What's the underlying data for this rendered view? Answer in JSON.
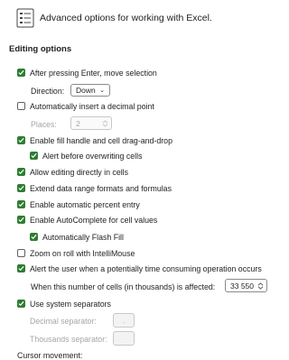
{
  "header": {
    "title": "Advanced options for working with Excel.",
    "icon": "sliders-list-icon"
  },
  "section": {
    "title": "Editing options"
  },
  "options": {
    "after_enter": {
      "label": "After pressing Enter, move selection",
      "checked": true
    },
    "direction": {
      "label": "Direction:",
      "value": "Down"
    },
    "auto_decimal": {
      "label": "Automatically insert a decimal point",
      "checked": false
    },
    "places": {
      "label": "Places:",
      "value": "2"
    },
    "fill_handle": {
      "label": "Enable fill handle and cell drag-and-drop",
      "checked": true
    },
    "alert_overwrite": {
      "label": "Alert before overwriting cells",
      "checked": true
    },
    "edit_in_cells": {
      "label": "Allow editing directly in cells",
      "checked": true
    },
    "extend_formats": {
      "label": "Extend data range formats and formulas",
      "checked": true
    },
    "auto_percent": {
      "label": "Enable automatic percent entry",
      "checked": true
    },
    "autocomplete": {
      "label": "Enable AutoComplete for cell values",
      "checked": true
    },
    "flash_fill": {
      "label": "Automatically Flash Fill",
      "checked": true
    },
    "zoom_roll": {
      "label": "Zoom on roll with IntelliMouse",
      "checked": false
    },
    "alert_time": {
      "label": "Alert the user when a potentially time consuming operation occurs",
      "checked": true
    },
    "cells_affected": {
      "label": "When this number of cells (in thousands) is affected:",
      "value": "33 550"
    },
    "system_separators": {
      "label": "Use system separators",
      "checked": true
    },
    "decimal_sep": {
      "label": "Decimal separator:",
      "value": "."
    },
    "thousands_sep": {
      "label": "Thousands separator:",
      "value": ""
    },
    "cursor_movement": {
      "label": "Cursor movement:"
    }
  },
  "colors": {
    "checkbox_checked": "#2e7d32",
    "disabled_text": "#a6a6a6"
  }
}
